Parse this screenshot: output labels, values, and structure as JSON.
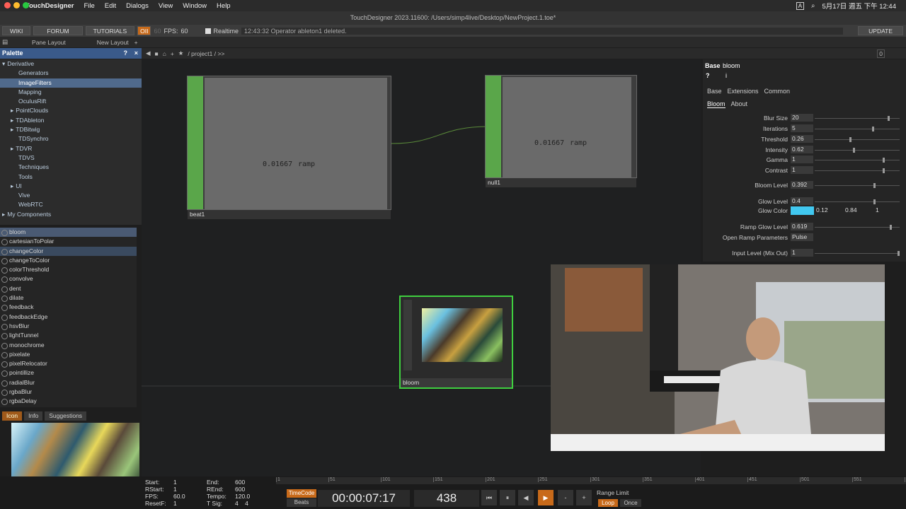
{
  "macmenu": {
    "app": "TouchDesigner",
    "items": [
      "File",
      "Edit",
      "Dialogs",
      "View",
      "Window",
      "Help"
    ],
    "clock": "5月17日 週五 下午 12:44",
    "input": "A"
  },
  "window": {
    "title": "TouchDesigner 2023.11600: /Users/simp4live/Desktop/NewProject.1.toe*"
  },
  "toolbar": {
    "wiki": "WIKI",
    "forum": "FORUM",
    "tutorials": "TUTORIALS",
    "oi": "OII",
    "fps_label": "FPS:",
    "fps_value": "60",
    "realtime": "Realtime",
    "status": "12:43:32 Operator ableton1 deleted.",
    "update": "UPDATE",
    "fps_dim": "60"
  },
  "panebar": {
    "pane_layout": "Pane Layout",
    "new_layout": "New Layout"
  },
  "palette": {
    "title": "Palette",
    "help": "?",
    "close": "×",
    "tree": [
      {
        "label": "Derivative",
        "indent": 0,
        "arrow": "▾"
      },
      {
        "label": "Generators",
        "indent": 1,
        "arrow": ""
      },
      {
        "label": "ImageFilters",
        "indent": 1,
        "arrow": "",
        "sel": true
      },
      {
        "label": "Mapping",
        "indent": 1,
        "arrow": ""
      },
      {
        "label": "OculusRift",
        "indent": 1,
        "arrow": ""
      },
      {
        "label": "PointClouds",
        "indent": 1,
        "arrow": "▸"
      },
      {
        "label": "TDAbleton",
        "indent": 1,
        "arrow": "▸"
      },
      {
        "label": "TDBitwig",
        "indent": 1,
        "arrow": "▸"
      },
      {
        "label": "TDSynchro",
        "indent": 1,
        "arrow": ""
      },
      {
        "label": "TDVR",
        "indent": 1,
        "arrow": "▸"
      },
      {
        "label": "TDVS",
        "indent": 1,
        "arrow": ""
      },
      {
        "label": "Techniques",
        "indent": 1,
        "arrow": ""
      },
      {
        "label": "Tools",
        "indent": 1,
        "arrow": ""
      },
      {
        "label": "UI",
        "indent": 1,
        "arrow": "▸"
      },
      {
        "label": "Vive",
        "indent": 1,
        "arrow": ""
      },
      {
        "label": "WebRTC",
        "indent": 1,
        "arrow": ""
      },
      {
        "label": "My Components",
        "indent": 0,
        "arrow": "▸"
      }
    ],
    "components": [
      "bloom",
      "cartesianToPolar",
      "changeColor",
      "changeToColor",
      "colorThreshold",
      "convolve",
      "dent",
      "dilate",
      "feedback",
      "feedbackEdge",
      "hsvBlur",
      "lightTunnel",
      "monochrome",
      "pixelate",
      "pixelRelocator",
      "pointillize",
      "radialBlur",
      "rgbaBlur",
      "rgbaDelay"
    ],
    "tabs": [
      "Icon",
      "Info",
      "Suggestions"
    ]
  },
  "network": {
    "path": "/ project1 / >>",
    "zoom": "0",
    "ops": [
      {
        "name": "beat1",
        "value": "0.01667",
        "label2": "ramp"
      },
      {
        "name": "null1",
        "value": "0.01667",
        "label2": "ramp"
      },
      {
        "name": "bloom"
      }
    ]
  },
  "params": {
    "type": "Base",
    "name": "bloom",
    "pages": [
      "Base",
      "Extensions",
      "Common"
    ],
    "subpages": [
      "Bloom",
      "About"
    ],
    "rows": [
      {
        "label": "Blur Size",
        "value": "20",
        "knob": 0.88
      },
      {
        "label": "Iterations",
        "value": "5",
        "knob": 0.69
      },
      {
        "label": "Threshold",
        "value": "0.26",
        "knob": 0.42
      },
      {
        "label": "Intensity",
        "value": "0.62",
        "knob": 0.46
      },
      {
        "label": "Gamma",
        "value": "1",
        "knob": 0.82
      },
      {
        "label": "Contrast",
        "value": "1",
        "knob": 0.82
      },
      {
        "label": "Bloom Level",
        "value": "0.392",
        "knob": 0.71
      },
      {
        "label": "Glow Level",
        "value": "0.4",
        "knob": 0.71
      },
      {
        "label": "Ramp Glow Level",
        "value": "0.619",
        "knob": 0.91
      },
      {
        "label": "Open Ramp Parameters",
        "value": "Pulse",
        "knob": null
      },
      {
        "label": "Input Level (Mix Out)",
        "value": "1",
        "knob": 1.0
      }
    ],
    "glow_color": {
      "label": "Glow Color",
      "swatch": "#41c8f0",
      "g": "0.12",
      "b": "0.84",
      "a": "1"
    }
  },
  "timeline": {
    "start_label": "Start:",
    "start": "1",
    "end_label": "End:",
    "end": "600",
    "rstart_label": "RStart:",
    "rstart": "1",
    "rend_label": "REnd:",
    "rend": "600",
    "fps_label": "FPS:",
    "fps": "60.0",
    "tempo_label": "Tempo:",
    "tempo": "120.0",
    "resetf_label": "ResetF:",
    "resetf": "1",
    "tsig_label": "T Sig:",
    "tsig": "4    4",
    "timecode_btn": "TimeCode",
    "beats_btn": "Beats",
    "timecode": "00:00:07:17",
    "frame": "438",
    "range_label": "Range Limit",
    "loop": "Loop",
    "once": "Once",
    "ticks": [
      "1",
      "51",
      "101",
      "151",
      "201",
      "251",
      "301",
      "351",
      "401",
      "451",
      "501",
      "551",
      "600"
    ]
  }
}
